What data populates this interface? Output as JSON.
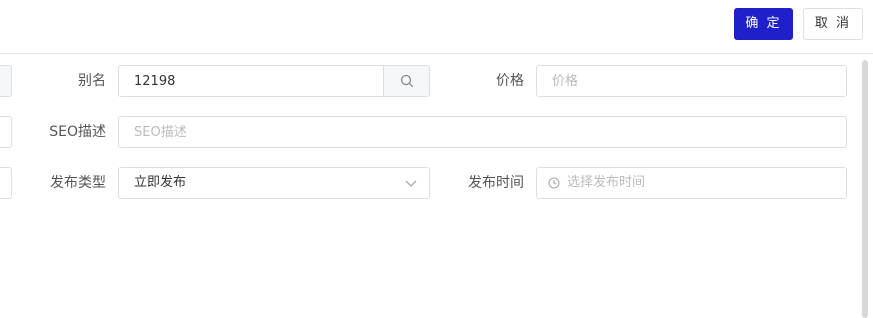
{
  "header": {
    "confirm_label": "确 定",
    "cancel_label": "取 消"
  },
  "form": {
    "alias": {
      "label": "别名",
      "value": "12198"
    },
    "price": {
      "label": "价格",
      "placeholder": "价格"
    },
    "seo": {
      "label": "SEO描述",
      "placeholder": "SEO描述"
    },
    "publish_type": {
      "label": "发布类型",
      "value": "立即发布"
    },
    "publish_time": {
      "label": "发布时间",
      "placeholder": "选择发布时间"
    }
  },
  "icons": {
    "search": "search-icon",
    "dropdown": "chevron-down-icon",
    "time": "clock-icon"
  },
  "colors": {
    "primary": "#1f1fcc",
    "border": "#dcdfe6",
    "placeholder": "#bbbbbb"
  }
}
